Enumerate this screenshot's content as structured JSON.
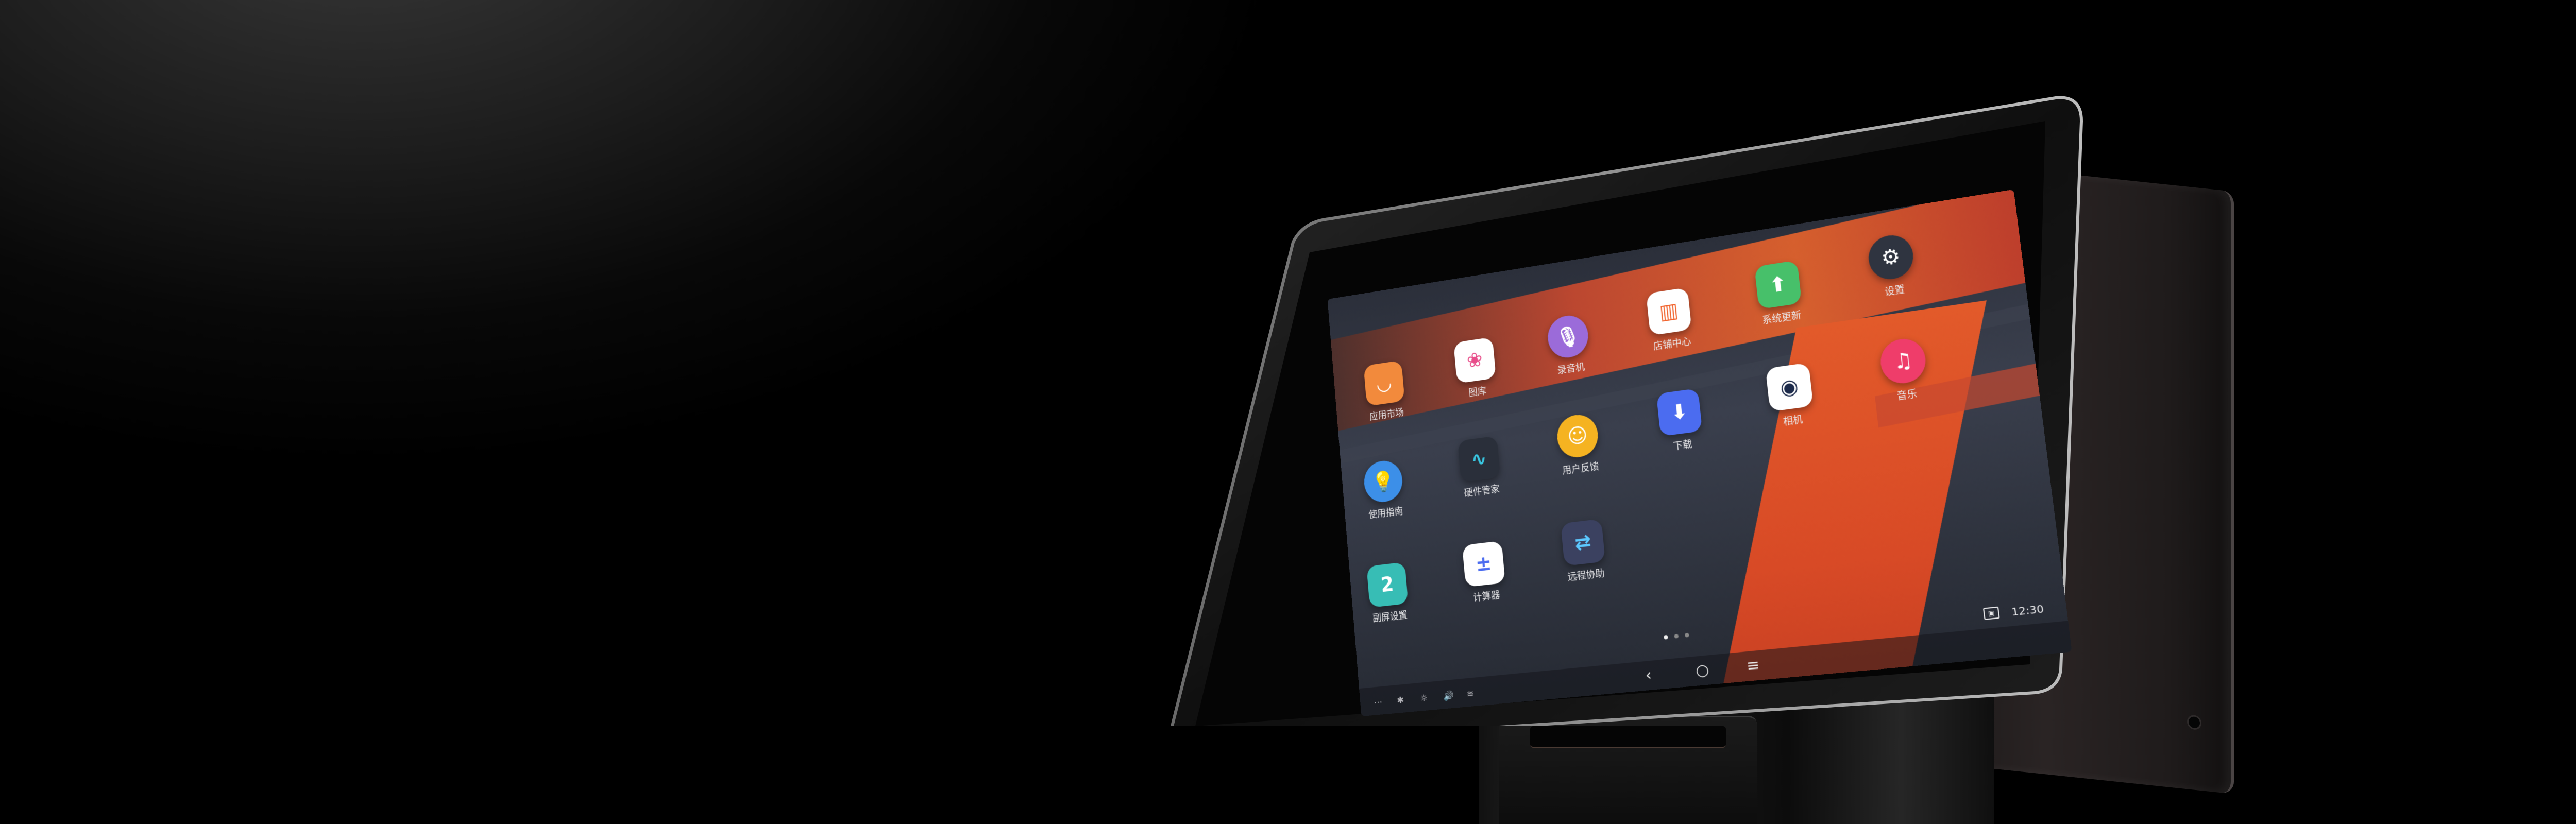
{
  "apps": [
    {
      "id": "app-store",
      "label": "应用市场",
      "glyph": "◡",
      "color": "#f28a3c",
      "round": false
    },
    {
      "id": "gallery",
      "label": "图库",
      "glyph": "❀",
      "color": "#ffffff",
      "fg": "#e84d8a",
      "round": false
    },
    {
      "id": "recorder",
      "label": "录音机",
      "glyph": "🎙",
      "color": "#9b6bd9",
      "round": true
    },
    {
      "id": "store-center",
      "label": "店铺中心",
      "glyph": "▥",
      "color": "#ffffff",
      "fg": "#f1642e",
      "round": false
    },
    {
      "id": "system-update",
      "label": "系统更新",
      "glyph": "⬆",
      "color": "#47c06a",
      "round": false
    },
    {
      "id": "settings",
      "label": "设置",
      "glyph": "⚙",
      "color": "#2f3440",
      "round": true
    },
    {
      "id": "user-guide",
      "label": "使用指南",
      "glyph": "💡",
      "color": "#3c8fe8",
      "round": true
    },
    {
      "id": "hardware-manager",
      "label": "硬件管家",
      "glyph": "∿",
      "color": "#2a2f3a",
      "fg": "#39c6e0",
      "round": false
    },
    {
      "id": "feedback",
      "label": "用户反馈",
      "glyph": "☺",
      "color": "#f5b321",
      "round": true
    },
    {
      "id": "download",
      "label": "下载",
      "glyph": "⬇",
      "color": "#4b6cf0",
      "round": false
    },
    {
      "id": "camera",
      "label": "相机",
      "glyph": "◉",
      "color": "#ffffff",
      "fg": "#1c2a4a",
      "round": false
    },
    {
      "id": "music",
      "label": "音乐",
      "glyph": "♫",
      "color": "#ef3d6a",
      "round": true
    },
    {
      "id": "secondary-screen-settings",
      "label": "副屏设置",
      "glyph": "2",
      "color": "#37bdb5",
      "round": false
    },
    {
      "id": "calculator",
      "label": "计算器",
      "glyph": "±",
      "color": "#ffffff",
      "fg": "#4b6cf0",
      "round": false
    },
    {
      "id": "remote-assist",
      "label": "远程协助",
      "glyph": "⇄",
      "color": "#3b4160",
      "fg": "#5cc8ff",
      "round": false
    }
  ],
  "statusbar": {
    "clock": "12:30"
  },
  "nav": {
    "back": "‹",
    "home": "○",
    "menu": "≡"
  },
  "tray": [
    "⋯",
    "✱",
    "☼",
    "🔊",
    "≋"
  ]
}
